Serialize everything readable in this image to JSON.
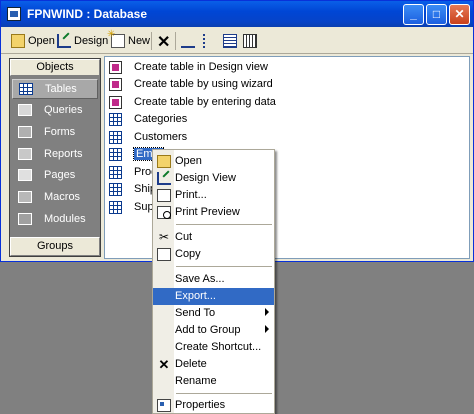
{
  "window": {
    "title": "FPNWIND : Database"
  },
  "titlebar_buttons": {
    "minimize": "_",
    "maximize": "□",
    "close": "✕"
  },
  "toolbar": {
    "open_label": "Open",
    "design_label": "Design",
    "new_label": "New",
    "delete_glyph": "✕"
  },
  "objects": {
    "header": "Objects",
    "items": [
      "Tables",
      "Queries",
      "Forms",
      "Reports",
      "Pages",
      "Macros",
      "Modules"
    ],
    "selected": "Tables",
    "groups_header": "Groups"
  },
  "list": {
    "rows": [
      "Create table in Design view",
      "Create table by using wizard",
      "Create table by entering data",
      "Categories",
      "Customers",
      "Empl",
      "Prod",
      "Shipp",
      "Supp"
    ],
    "selected_row": "Empl"
  },
  "context_menu": {
    "items": [
      {
        "label": "Open",
        "icon": "open-icon"
      },
      {
        "label": "Design View",
        "icon": "design-icon"
      },
      {
        "label": "Print...",
        "icon": "print-icon"
      },
      {
        "label": "Print Preview",
        "icon": "print-preview-icon"
      },
      {
        "label": "Cut",
        "icon": "scissors-icon"
      },
      {
        "label": "Copy",
        "icon": "copy-icon"
      },
      {
        "label": "Save As..."
      },
      {
        "label": "Export..."
      },
      {
        "label": "Send To",
        "submenu": true
      },
      {
        "label": "Add to Group",
        "submenu": true
      },
      {
        "label": "Create Shortcut..."
      },
      {
        "label": "Delete",
        "icon": "delete-icon"
      },
      {
        "label": "Rename"
      },
      {
        "label": "Properties",
        "icon": "properties-icon"
      }
    ],
    "highlighted": "Export..."
  },
  "colors": {
    "title_blue": "#0A5FE8",
    "highlight": "#316AC5",
    "workspace": "#808080"
  }
}
